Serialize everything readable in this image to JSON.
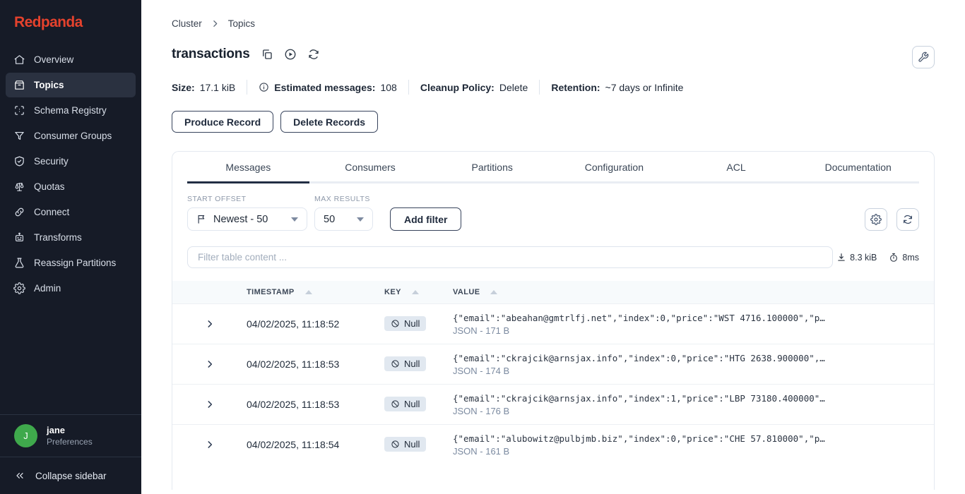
{
  "sidebar": {
    "logo": "Redpanda",
    "items": [
      {
        "label": "Overview",
        "active": false
      },
      {
        "label": "Topics",
        "active": true
      },
      {
        "label": "Schema Registry",
        "active": false
      },
      {
        "label": "Consumer Groups",
        "active": false
      },
      {
        "label": "Security",
        "active": false
      },
      {
        "label": "Quotas",
        "active": false
      },
      {
        "label": "Connect",
        "active": false
      },
      {
        "label": "Transforms",
        "active": false
      },
      {
        "label": "Reassign Partitions",
        "active": false
      },
      {
        "label": "Admin",
        "active": false
      }
    ],
    "user": {
      "initial": "J",
      "name": "jane",
      "subtitle": "Preferences",
      "avatar_color": "#3fa94c"
    },
    "collapse_label": "Collapse sidebar"
  },
  "breadcrumb": {
    "item1": "Cluster",
    "item2": "Topics"
  },
  "header": {
    "title": "transactions"
  },
  "stats": {
    "size_label": "Size:",
    "size_value": "17.1 kiB",
    "messages_label": "Estimated messages:",
    "messages_value": "108",
    "cleanup_label": "Cleanup Policy:",
    "cleanup_value": "Delete",
    "retention_label": "Retention:",
    "retention_value": "~7 days or Infinite"
  },
  "actions": {
    "produce_label": "Produce Record",
    "delete_label": "Delete Records"
  },
  "tabs": [
    {
      "label": "Messages",
      "active": true
    },
    {
      "label": "Consumers",
      "active": false
    },
    {
      "label": "Partitions",
      "active": false
    },
    {
      "label": "Configuration",
      "active": false
    },
    {
      "label": "ACL",
      "active": false
    },
    {
      "label": "Documentation",
      "active": false
    }
  ],
  "filters": {
    "start_offset_label": "START OFFSET",
    "start_offset_value": "Newest - 50",
    "max_results_label": "MAX RESULTS",
    "max_results_value": "50",
    "add_filter_label": "Add filter",
    "search_placeholder": "Filter table content ...",
    "payload_size": "8.3 kiB",
    "elapsed_time": "8ms"
  },
  "table": {
    "columns": {
      "timestamp": "TIMESTAMP",
      "key": "KEY",
      "value": "VALUE"
    },
    "rows": [
      {
        "timestamp": "04/02/2025, 11:18:52",
        "key": "Null",
        "value": "{\"email\":\"abeahan@gmtrlfj.net\",\"index\":0,\"price\":\"WST 4716.100000\",\"p…",
        "meta": "JSON - 171 B"
      },
      {
        "timestamp": "04/02/2025, 11:18:53",
        "key": "Null",
        "value": "{\"email\":\"ckrajcik@arnsjax.info\",\"index\":0,\"price\":\"HTG 2638.900000\",…",
        "meta": "JSON - 174 B"
      },
      {
        "timestamp": "04/02/2025, 11:18:53",
        "key": "Null",
        "value": "{\"email\":\"ckrajcik@arnsjax.info\",\"index\":1,\"price\":\"LBP 73180.400000\"…",
        "meta": "JSON - 176 B"
      },
      {
        "timestamp": "04/02/2025, 11:18:54",
        "key": "Null",
        "value": "{\"email\":\"alubowitz@pulbjmb.biz\",\"index\":0,\"price\":\"CHE 57.810000\",\"p…",
        "meta": "JSON - 161 B"
      }
    ]
  },
  "colors": {
    "brand_red": "#e5422d",
    "sidebar_bg": "#161b27",
    "avatar_green": "#3fa94c",
    "active_tab_underline": "#222e44",
    "badge_bg": "#e1e8f0"
  }
}
